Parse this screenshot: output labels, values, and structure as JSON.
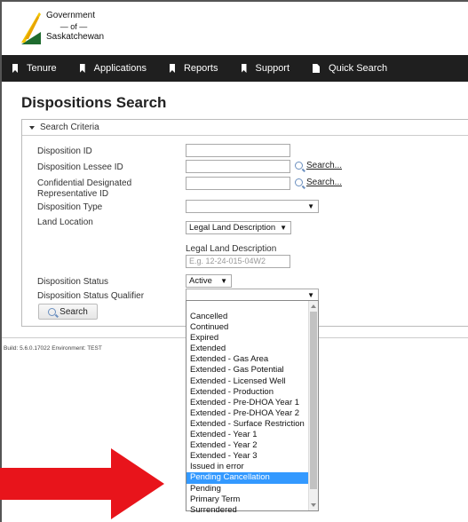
{
  "header": {
    "logo_line1": "Government",
    "logo_line2": "of",
    "logo_line3": "Saskatchewan",
    "logo_icon": "saskatchewan-flag-icon"
  },
  "nav": {
    "items": [
      {
        "label": "Tenure",
        "icon": "bookmark-icon"
      },
      {
        "label": "Applications",
        "icon": "bookmark-icon"
      },
      {
        "label": "Reports",
        "icon": "bookmark-icon"
      },
      {
        "label": "Support",
        "icon": "bookmark-icon"
      },
      {
        "label": "Quick Search",
        "icon": "document-icon"
      }
    ]
  },
  "page": {
    "title": "Dispositions Search"
  },
  "search_criteria": {
    "heading": "Search Criteria",
    "disposition_id_label": "Disposition ID",
    "disposition_id_value": "",
    "lessee_id_label": "Disposition Lessee ID",
    "lessee_id_value": "",
    "lessee_search_link": "Search...",
    "rep_id_label": "Confidential Designated Representative ID",
    "rep_id_value": "",
    "rep_search_link": "Search...",
    "disposition_type_label": "Disposition Type",
    "disposition_type_value": "",
    "land_location_label": "Land Location",
    "land_location_value": "Legal Land Description",
    "lld_label": "Legal Land Description",
    "lld_placeholder": "E.g. 12-24-015-04W2",
    "status_label": "Disposition Status",
    "status_value": "Active",
    "qualifier_label": "Disposition Status Qualifier",
    "qualifier_value": "",
    "search_button": "Search"
  },
  "footer": {
    "build": "Build: 5.6.0.17022 Environment: TEST"
  },
  "qualifier_dropdown": {
    "selected": "Pending Cancellation",
    "options": [
      "Cancelled",
      "Continued",
      "Expired",
      "Extended",
      "Extended - Gas Area",
      "Extended - Gas Potential",
      "Extended - Licensed Well",
      "Extended - Production",
      "Extended - Pre-DHOA Year 1",
      "Extended - Pre-DHOA Year 2",
      "Extended - Surface Restriction",
      "Extended - Year 1",
      "Extended - Year 2",
      "Extended - Year 3",
      "Issued in error",
      "Pending Cancellation",
      "Pending",
      "Primary Term",
      "Surrendered"
    ]
  },
  "annotation": {
    "arrow_color": "#e8141b"
  }
}
